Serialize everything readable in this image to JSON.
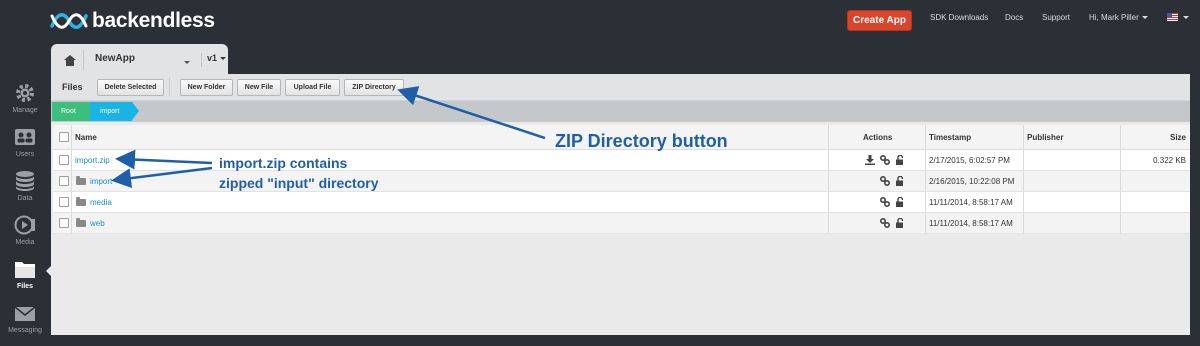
{
  "brand": {
    "logo_text": "backendless"
  },
  "topnav": {
    "create_app": "Create App",
    "sdk_downloads": "SDK Downloads",
    "docs": "Docs",
    "support": "Support",
    "user": "Hi, Mark Piller",
    "flag_icon": "us-flag-icon"
  },
  "sidebar": {
    "items": [
      {
        "label": "Manage",
        "icon": "gear-icon"
      },
      {
        "label": "Users",
        "icon": "users-icon"
      },
      {
        "label": "Data",
        "icon": "database-icon"
      },
      {
        "label": "Media",
        "icon": "media-icon"
      },
      {
        "label": "Files",
        "icon": "folder-icon",
        "active": true
      },
      {
        "label": "Messaging",
        "icon": "mail-icon"
      }
    ]
  },
  "appbar": {
    "app_name": "NewApp",
    "version": "v1"
  },
  "toolbar": {
    "title": "Files",
    "delete_selected": "Delete Selected",
    "new_folder": "New Folder",
    "new_file": "New File",
    "upload_file": "Upload File",
    "zip_directory": "ZIP Directory"
  },
  "breadcrumb": {
    "root": "Root",
    "current": "import"
  },
  "table": {
    "headers": {
      "name": "Name",
      "actions": "Actions",
      "timestamp": "Timestamp",
      "publisher": "Publisher",
      "size": "Size"
    },
    "rows": [
      {
        "name": "import.zip",
        "type": "file",
        "timestamp": "2/17/2015, 6:02:57 PM",
        "publisher": "",
        "size": "0.322 KB"
      },
      {
        "name": "import",
        "type": "folder",
        "timestamp": "2/16/2015, 10:22:08 PM",
        "publisher": "",
        "size": ""
      },
      {
        "name": "media",
        "type": "folder",
        "timestamp": "11/11/2014, 8:58:17 AM",
        "publisher": "",
        "size": ""
      },
      {
        "name": "web",
        "type": "folder",
        "timestamp": "11/11/2014, 8:58:17 AM",
        "publisher": "",
        "size": ""
      }
    ]
  },
  "annotations": {
    "zip_button": "ZIP Directory button",
    "contains_line1": "import.zip contains",
    "contains_line2": "zipped \"input\" directory",
    "color": "#1f5fa8"
  },
  "colors": {
    "accent_green": "#3cbf7c",
    "accent_blue": "#1ab3e6",
    "create_btn": "#d9452b",
    "link": "#1a8fc9"
  }
}
